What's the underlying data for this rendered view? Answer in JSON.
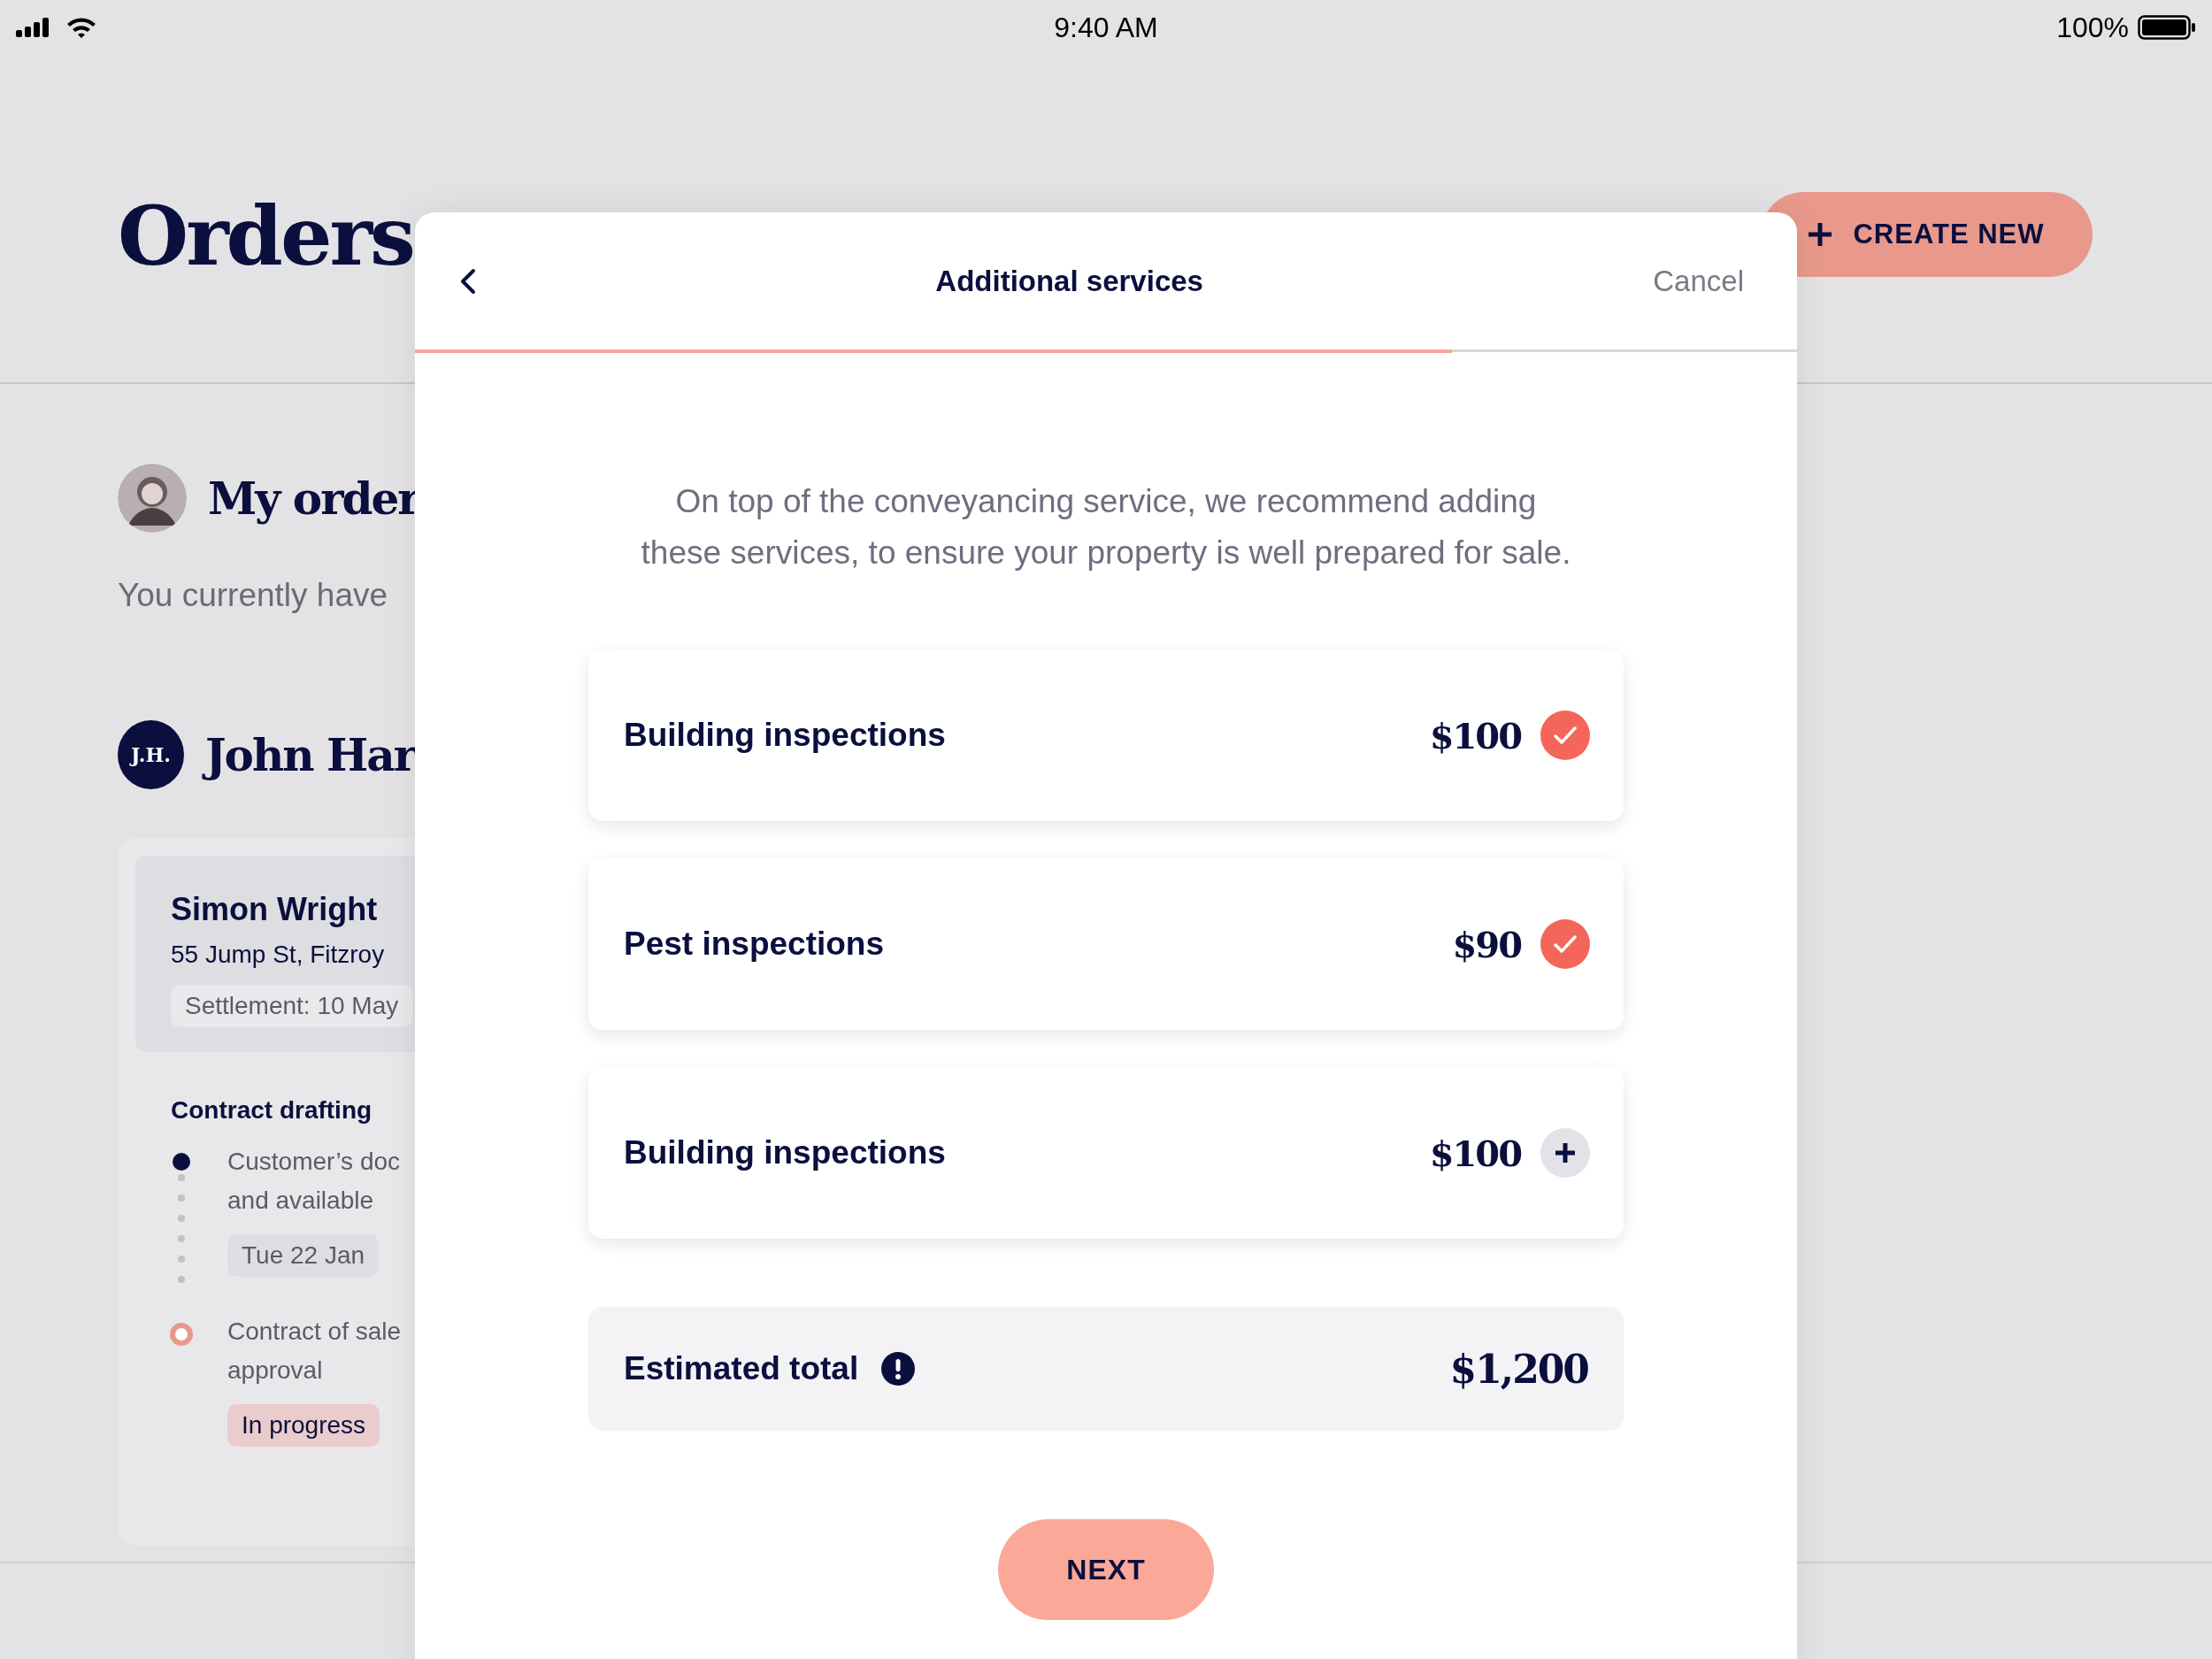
{
  "status_bar": {
    "time": "9:40 AM",
    "battery": "100%"
  },
  "page": {
    "title": "Orders",
    "create_button": "CREATE NEW"
  },
  "my_orders": {
    "heading": "My order",
    "summary": "You currently have"
  },
  "client": {
    "initials": "J.H.",
    "name": "John Har"
  },
  "order_card": {
    "name": "Simon Wright",
    "address": "55 Jump St, Fitzroy",
    "settlement": "Settlement: 10 May",
    "stage": "Contract drafting",
    "steps": [
      {
        "lines": [
          "Customer’s doc",
          "and available"
        ],
        "tag": "Tue 22 Jan",
        "kind": "done"
      },
      {
        "lines": [
          "Contract of sale",
          "approval"
        ],
        "tag": "In progress",
        "kind": "current"
      }
    ]
  },
  "modal": {
    "title": "Additional services",
    "cancel": "Cancel",
    "progress": {
      "level": 0.75
    },
    "intro": [
      "On top of the conveyancing service, we recommend adding",
      "these services, to ensure your property is well prepared for sale."
    ],
    "services": [
      {
        "name": "Building inspections",
        "price": "$100",
        "selected": true
      },
      {
        "name": "Pest inspections",
        "price": "$90",
        "selected": true
      },
      {
        "name": "Building inspections",
        "price": "$100",
        "selected": false
      }
    ],
    "total": {
      "label": "Estimated total",
      "value": "$1,200"
    },
    "next_button": "NEXT"
  }
}
